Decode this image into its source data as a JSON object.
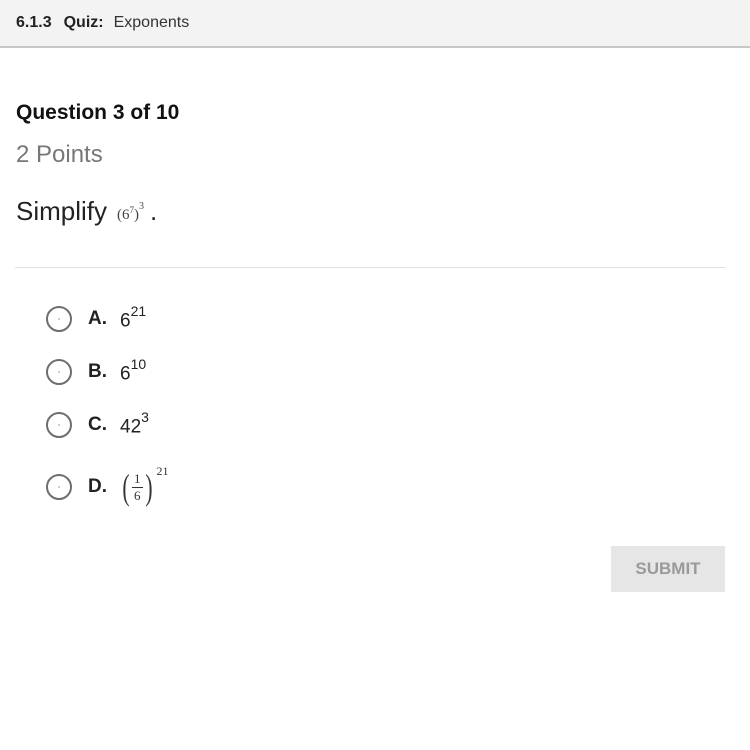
{
  "header": {
    "quiz_number": "6.1.3",
    "quiz_label": "Quiz:",
    "quiz_title": "Exponents"
  },
  "question": {
    "heading": "Question 3 of 10",
    "points": "2 Points",
    "prompt_text": "Simplify",
    "prompt_base": "6",
    "prompt_inner_exp": "7",
    "prompt_outer_exp": "3",
    "prompt_period": "."
  },
  "options": [
    {
      "letter": "A.",
      "base": "6",
      "exp": "21"
    },
    {
      "letter": "B.",
      "base": "6",
      "exp": "10"
    },
    {
      "letter": "C.",
      "base": "42",
      "exp": "3"
    },
    {
      "letter": "D.",
      "numerator": "1",
      "denominator": "6",
      "exp": "21"
    }
  ],
  "submit_label": "SUBMIT"
}
